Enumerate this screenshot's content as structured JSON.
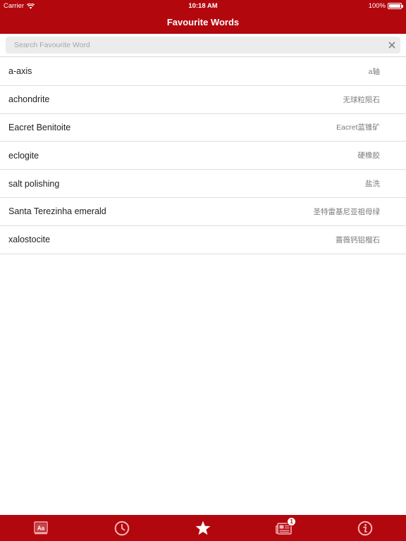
{
  "status_bar": {
    "carrier": "Carrier",
    "time": "10:18 AM",
    "battery_percent": "100%",
    "battery_level": 1.0
  },
  "nav": {
    "title": "Favourite Words"
  },
  "search": {
    "placeholder": "Search Favourite Word",
    "value": ""
  },
  "words": [
    {
      "word": "a-axis",
      "translation": "a轴"
    },
    {
      "word": "achondrite",
      "translation": "无球粒陨石"
    },
    {
      "word": "Eacret Benitoite",
      "translation": "Eacret蓝锥矿"
    },
    {
      "word": "eclogite",
      "translation": "硬橡胶"
    },
    {
      "word": "salt polishing",
      "translation": "盐洗"
    },
    {
      "word": "Santa Terezinha emerald",
      "translation": "圣特雷基尼亚祖母绿"
    },
    {
      "word": "xalostocite",
      "translation": "蔷薇钙铝榴石"
    }
  ],
  "tab_bar": {
    "tabs": [
      {
        "icon": "dictionary-icon"
      },
      {
        "icon": "history-clock-icon"
      },
      {
        "icon": "favourites-star-icon"
      },
      {
        "icon": "news-icon",
        "badge": "1"
      },
      {
        "icon": "info-icon"
      }
    ]
  },
  "colors": {
    "brand_red": "#b3070e",
    "text_primary": "#222222",
    "text_secondary": "#7b7b7b",
    "separator": "#dedede"
  }
}
